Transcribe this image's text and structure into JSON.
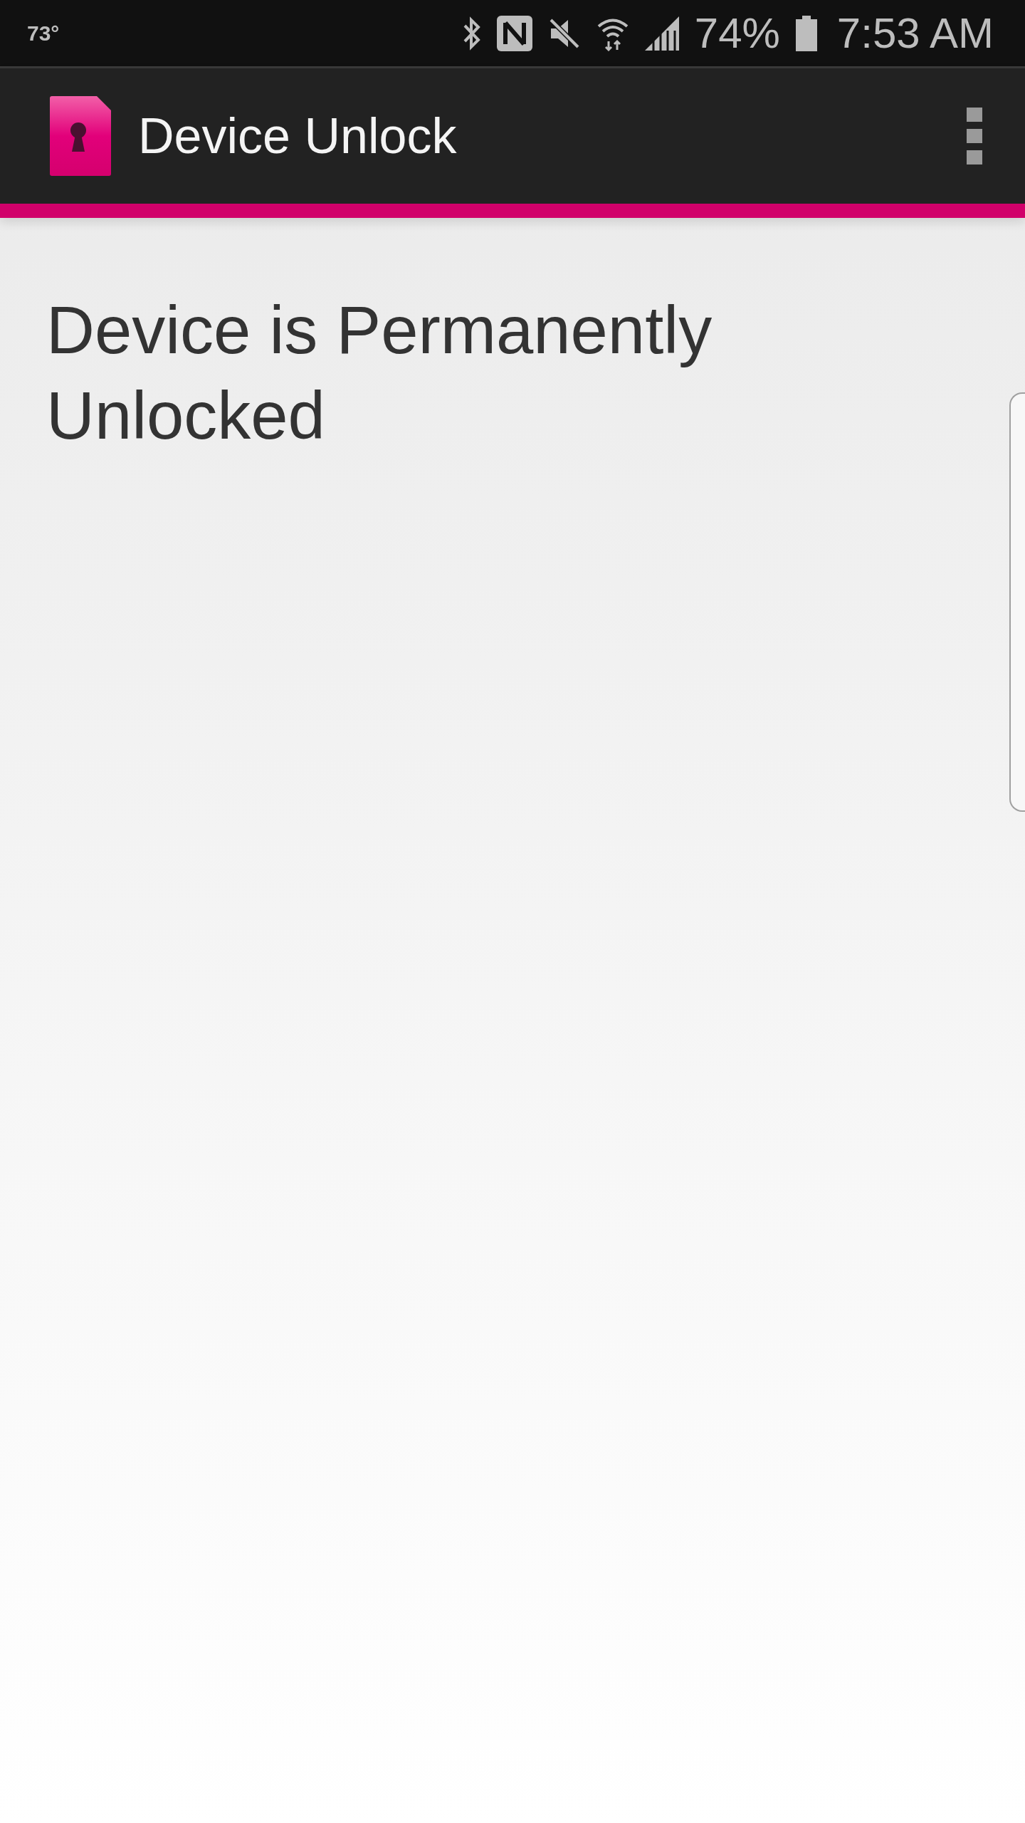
{
  "status_bar": {
    "temperature": "73°",
    "battery": "74%",
    "time": "7:53 AM"
  },
  "app_bar": {
    "title": "Device Unlock"
  },
  "content": {
    "heading": "Device is Permanently Unlocked"
  }
}
